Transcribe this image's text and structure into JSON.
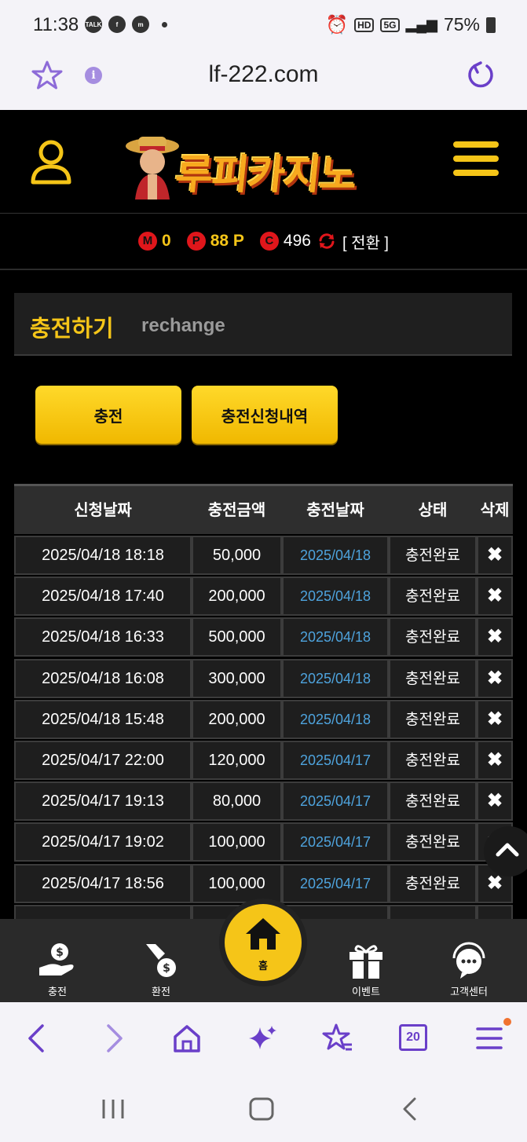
{
  "status_bar": {
    "time": "11:38",
    "battery": "75%",
    "app_icons": [
      "talk-icon",
      "facebook-icon",
      "messenger-icon"
    ]
  },
  "browser": {
    "url": "lf-222.com",
    "tab_count": "20"
  },
  "site": {
    "logo_text": "루피카지노",
    "points": {
      "m_badge": "M",
      "m_value": "0",
      "p_badge": "P",
      "p_value": "88 P",
      "c_badge": "C",
      "c_value": "496",
      "switch_label": "[ 전환 ]"
    }
  },
  "page": {
    "title_ko": "충전하기",
    "title_en": "rechange",
    "buttons": {
      "charge": "충전",
      "history": "충전신청내역"
    }
  },
  "table": {
    "headers": [
      "신청날짜",
      "충전금액",
      "충전날짜",
      "상태",
      "삭제"
    ],
    "rows": [
      {
        "requested": "2025/04/18 18:18",
        "amount": "50,000",
        "charged": "2025/04/18",
        "status": "충전완료",
        "delete": "✖"
      },
      {
        "requested": "2025/04/18 17:40",
        "amount": "200,000",
        "charged": "2025/04/18",
        "status": "충전완료",
        "delete": "✖"
      },
      {
        "requested": "2025/04/18 16:33",
        "amount": "500,000",
        "charged": "2025/04/18",
        "status": "충전완료",
        "delete": "✖"
      },
      {
        "requested": "2025/04/18 16:08",
        "amount": "300,000",
        "charged": "2025/04/18",
        "status": "충전완료",
        "delete": "✖"
      },
      {
        "requested": "2025/04/18 15:48",
        "amount": "200,000",
        "charged": "2025/04/18",
        "status": "충전완료",
        "delete": "✖"
      },
      {
        "requested": "2025/04/17 22:00",
        "amount": "120,000",
        "charged": "2025/04/17",
        "status": "충전완료",
        "delete": "✖"
      },
      {
        "requested": "2025/04/17 19:13",
        "amount": "80,000",
        "charged": "2025/04/17",
        "status": "충전완료",
        "delete": "✖"
      },
      {
        "requested": "2025/04/17 19:02",
        "amount": "100,000",
        "charged": "2025/04/17",
        "status": "충전완료",
        "delete": "✖"
      },
      {
        "requested": "2025/04/17 18:56",
        "amount": "100,000",
        "charged": "2025/04/17",
        "status": "충전완료",
        "delete": "✖"
      }
    ]
  },
  "site_nav": {
    "charge": "충전",
    "exchange": "환전",
    "home": "홈",
    "event": "이벤트",
    "support": "고객센터"
  },
  "colors": {
    "accent_yellow": "#f5c518",
    "badge_red": "#e0161b",
    "link_blue": "#4ea3dd",
    "browser_purple": "#6a3fc9"
  }
}
